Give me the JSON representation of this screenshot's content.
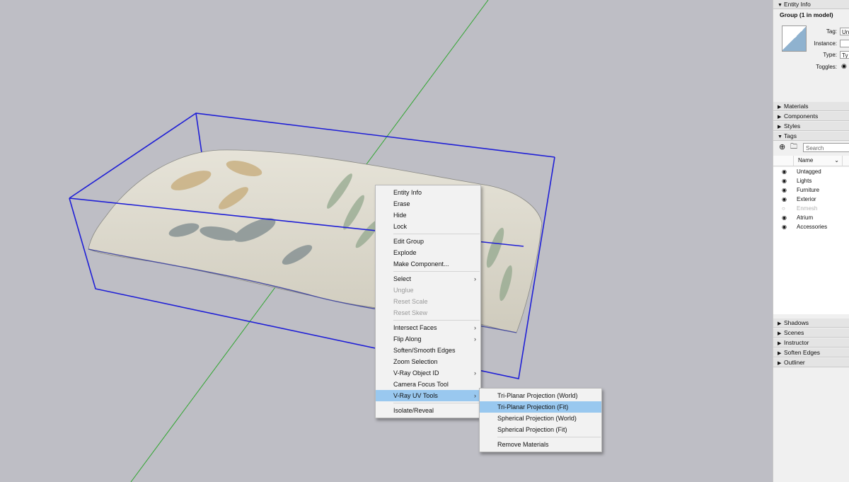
{
  "context_menu": {
    "items": [
      {
        "label": "Entity Info",
        "state": "normal",
        "submenu": false
      },
      {
        "label": "Erase",
        "state": "normal",
        "submenu": false
      },
      {
        "label": "Hide",
        "state": "normal",
        "submenu": false
      },
      {
        "label": "Lock",
        "state": "normal",
        "submenu": false
      },
      {
        "separator": true
      },
      {
        "label": "Edit Group",
        "state": "normal",
        "submenu": false
      },
      {
        "label": "Explode",
        "state": "normal",
        "submenu": false
      },
      {
        "label": "Make Component...",
        "state": "normal",
        "submenu": false
      },
      {
        "separator": true
      },
      {
        "label": "Select",
        "state": "normal",
        "submenu": true
      },
      {
        "label": "Unglue",
        "state": "disabled",
        "submenu": false
      },
      {
        "label": "Reset Scale",
        "state": "disabled",
        "submenu": false
      },
      {
        "label": "Reset Skew",
        "state": "disabled",
        "submenu": false
      },
      {
        "separator": true
      },
      {
        "label": "Intersect Faces",
        "state": "normal",
        "submenu": true
      },
      {
        "label": "Flip Along",
        "state": "normal",
        "submenu": true
      },
      {
        "label": "Soften/Smooth Edges",
        "state": "normal",
        "submenu": false
      },
      {
        "label": "Zoom Selection",
        "state": "normal",
        "submenu": false
      },
      {
        "label": "V-Ray Object ID",
        "state": "normal",
        "submenu": true
      },
      {
        "label": "Camera Focus Tool",
        "state": "normal",
        "submenu": false
      },
      {
        "label": "V-Ray UV Tools",
        "state": "highlighted",
        "submenu": true
      },
      {
        "separator": true
      },
      {
        "label": "Isolate/Reveal",
        "state": "normal",
        "submenu": false
      }
    ]
  },
  "submenu": {
    "items": [
      {
        "label": "Tri-Planar Projection (World)",
        "state": "normal"
      },
      {
        "label": "Tri-Planar Projection (Fit)",
        "state": "highlighted"
      },
      {
        "label": "Spherical Projection (World)",
        "state": "normal"
      },
      {
        "label": "Spherical Projection (Fit)",
        "state": "normal"
      },
      {
        "separator": true
      },
      {
        "label": "Remove Materials",
        "state": "normal"
      }
    ]
  },
  "tray": {
    "entity_info": {
      "header": "Entity Info",
      "title": "Group (1 in model)",
      "tag_label": "Tag:",
      "tag_value": "Un",
      "instance_label": "Instance:",
      "instance_value": "",
      "type_label": "Type:",
      "type_value": "Ty",
      "toggles_label": "Toggles:"
    },
    "collapsed_panels_top": [
      "Materials",
      "Components",
      "Styles"
    ],
    "tags_panel": {
      "header": "Tags",
      "search_placeholder": "Search",
      "column_name": "Name",
      "tags": [
        {
          "name": "Untagged",
          "visible": true
        },
        {
          "name": "Lights",
          "visible": true
        },
        {
          "name": "Furniture",
          "visible": true
        },
        {
          "name": "Exterior",
          "visible": true
        },
        {
          "name": "Enmesh",
          "visible": false
        },
        {
          "name": "Atrium",
          "visible": true
        },
        {
          "name": "Accessories",
          "visible": true
        }
      ]
    },
    "collapsed_panels_bottom": [
      "Shadows",
      "Scenes",
      "Instructor",
      "Soften Edges",
      "Outliner"
    ]
  },
  "colors": {
    "viewport_bg": "#bebec5",
    "selection_box": "#1f1fd6",
    "green_axis": "#2ea52e",
    "menu_highlight": "#99c8ef"
  }
}
